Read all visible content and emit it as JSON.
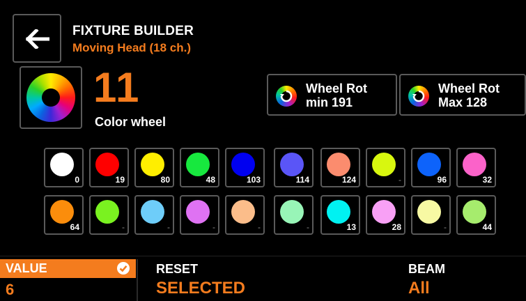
{
  "header": {
    "title": "FIXTURE BUILDER",
    "subtitle": "Moving Head (18 ch.)",
    "back_icon": "arrow-left-icon"
  },
  "channel": {
    "number": "11",
    "label": "Color wheel",
    "icon": "color-wheel-icon"
  },
  "wheel_rotation": [
    {
      "line1": "Wheel Rot",
      "line2": "min 191"
    },
    {
      "line1": "Wheel Rot",
      "line2": "Max 128"
    }
  ],
  "colors": [
    {
      "color": "#ffffff",
      "value": "0"
    },
    {
      "color": "#ff0000",
      "value": "19"
    },
    {
      "color": "#ffee00",
      "value": "80"
    },
    {
      "color": "#17e83e",
      "value": "48"
    },
    {
      "color": "#0000f0",
      "value": "103"
    },
    {
      "color": "#5a55f7",
      "value": "114"
    },
    {
      "color": "#fb8c6e",
      "value": "124"
    },
    {
      "color": "#d8f70f",
      "value": "-"
    },
    {
      "color": "#0d63fb",
      "value": "96"
    },
    {
      "color": "#fb62c9",
      "value": "32"
    },
    {
      "color": "#fb8d0c",
      "value": "64"
    },
    {
      "color": "#7af220",
      "value": "-"
    },
    {
      "color": "#6ecdf9",
      "value": "-"
    },
    {
      "color": "#df72f3",
      "value": "-"
    },
    {
      "color": "#fbbd8a",
      "value": "-"
    },
    {
      "color": "#98f5b7",
      "value": "-"
    },
    {
      "color": "#00f2f2",
      "value": "13"
    },
    {
      "color": "#f8a0f5",
      "value": "28"
    },
    {
      "color": "#f7f9a3",
      "value": "-"
    },
    {
      "color": "#a6ec6d",
      "value": "44"
    }
  ],
  "footer": {
    "value_label": "VALUE",
    "value": "6",
    "value_icon": "check-circle-icon",
    "reset_label": "RESET",
    "reset_value": "SELECTED",
    "beam_label": "BEAM",
    "beam_value": "All"
  },
  "accent_color": "#f47c1e"
}
